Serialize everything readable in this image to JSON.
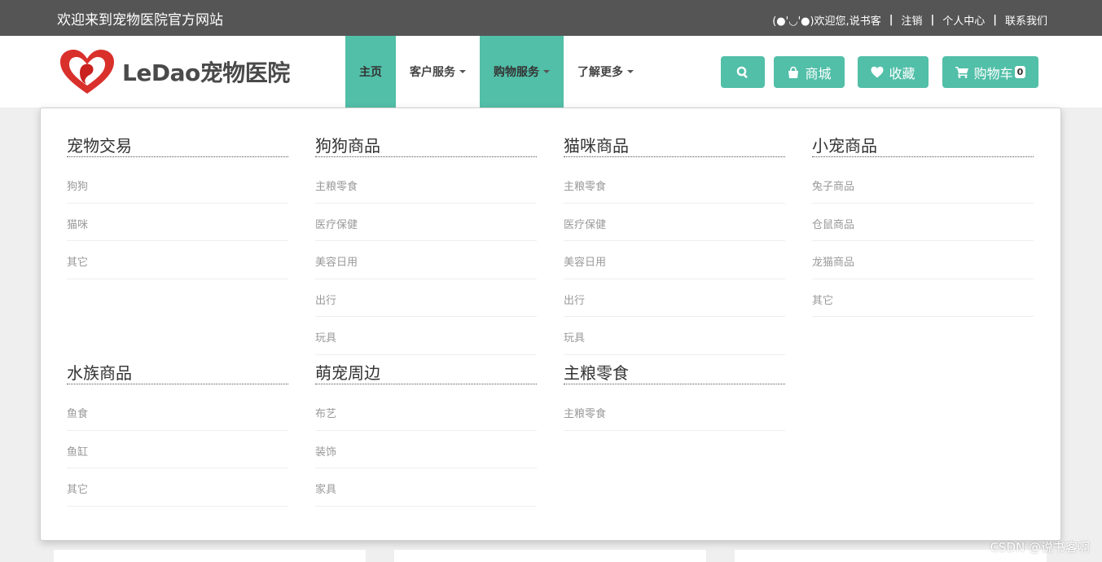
{
  "topbar": {
    "welcome": "欢迎来到宠物医院官方网站",
    "user_greeting": "(●'◡'●)欢迎您,说书客",
    "logout": "注销",
    "personal_center": "个人中心",
    "contact": "联系我们",
    "separator": "|"
  },
  "header": {
    "logo_text": "LeDao宠物医院",
    "nav": [
      {
        "label": "主页",
        "active": true,
        "dropdown": false
      },
      {
        "label": "客户服务",
        "active": false,
        "dropdown": true
      },
      {
        "label": "购物服务",
        "active": true,
        "dropdown": true
      },
      {
        "label": "了解更多",
        "active": false,
        "dropdown": true
      }
    ],
    "buttons": {
      "search_icon": "search-icon",
      "shop_label": "商城",
      "favorites_label": "收藏",
      "cart_label": "购物车",
      "cart_count": "0"
    }
  },
  "mega_menu": {
    "columns": [
      {
        "title": "宠物交易",
        "items": [
          "狗狗",
          "猫咪",
          "其它"
        ]
      },
      {
        "title": "狗狗商品",
        "items": [
          "主粮零食",
          "医疗保健",
          "美容日用",
          "出行",
          "玩具"
        ]
      },
      {
        "title": "猫咪商品",
        "items": [
          "主粮零食",
          "医疗保健",
          "美容日用",
          "出行",
          "玩具"
        ]
      },
      {
        "title": "小宠商品",
        "items": [
          "兔子商品",
          "仓鼠商品",
          "龙猫商品",
          "其它"
        ]
      },
      {
        "title": "水族商品",
        "items": [
          "鱼食",
          "鱼缸",
          "其它"
        ]
      },
      {
        "title": "萌宠周边",
        "items": [
          "布艺",
          "装饰",
          "家具"
        ]
      },
      {
        "title": "主粮零食",
        "items": [
          "主粮零食"
        ]
      }
    ]
  },
  "watermark": "CSDN @说书客啊",
  "colors": {
    "accent": "#52bfa8",
    "topbar": "#555555",
    "background": "#efefef"
  }
}
